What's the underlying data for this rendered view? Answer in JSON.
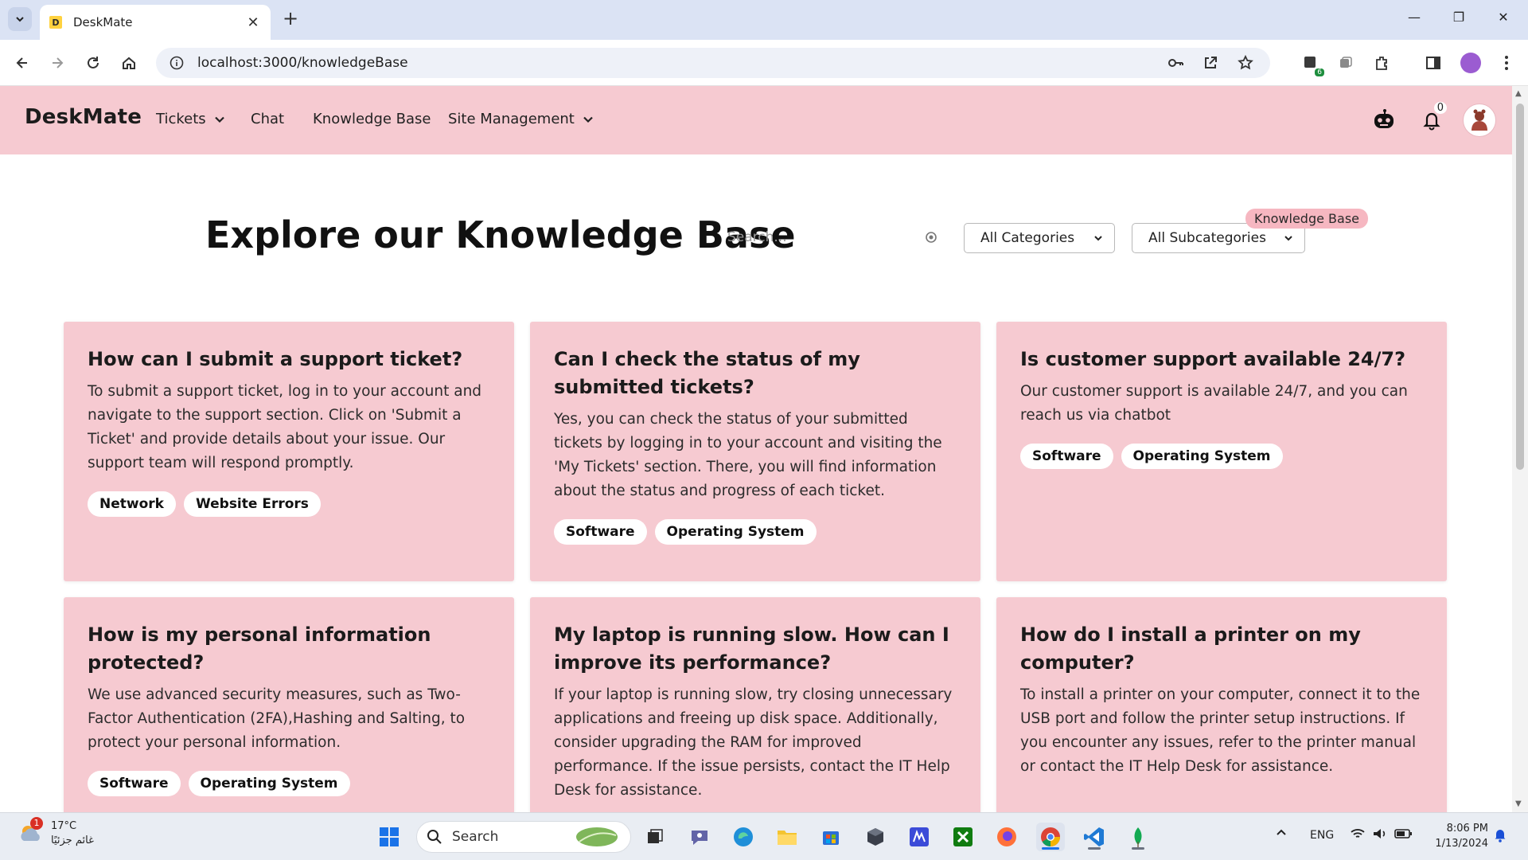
{
  "browser": {
    "tab_title": "DeskMate",
    "favicon_letter": "D",
    "url": "localhost:3000/knowledgeBase",
    "extension_badge": "6"
  },
  "app": {
    "brand": "DeskMate",
    "nav": {
      "tickets": "Tickets",
      "chat": "Chat",
      "knowledge_base": "Knowledge Base",
      "site_management": "Site Management"
    },
    "notification_count": "0"
  },
  "hero": {
    "title": "Explore our Knowledge Base",
    "search_placeholder": "Search...",
    "category_select": "All Categories",
    "subcategory_select": "All Subcategories",
    "tooltip": "Knowledge Base"
  },
  "articles": [
    {
      "title": "How can I submit a support ticket?",
      "body": "To submit a support ticket, log in to your account and navigate to the support section. Click on 'Submit a Ticket' and provide details about your issue. Our support team will respond promptly.",
      "tags": [
        "Network",
        "Website Errors"
      ]
    },
    {
      "title": "Can I check the status of my submitted tickets?",
      "body": "Yes, you can check the status of your submitted tickets by logging in to your account and visiting the 'My Tickets' section. There, you will find information about the status and progress of each ticket.",
      "tags": [
        "Software",
        "Operating System"
      ]
    },
    {
      "title": "Is customer support available 24/7?",
      "body": "Our customer support is available 24/7, and you can reach us via chatbot",
      "tags": [
        "Software",
        "Operating System"
      ]
    },
    {
      "title": "How is my personal information protected?",
      "body": "We use advanced security measures, such as Two-Factor Authentication (2FA),Hashing and Salting, to protect your personal information.",
      "tags": [
        "Software",
        "Operating System"
      ]
    },
    {
      "title": "My laptop is running slow. How can I improve its performance?",
      "body": "If your laptop is running slow, try closing unnecessary applications and freeing up disk space. Additionally, consider upgrading the RAM for improved performance. If the issue persists, contact the IT Help Desk for assistance.",
      "tags": []
    },
    {
      "title": "How do I install a printer on my computer?",
      "body": "To install a printer on your computer, connect it to the USB port and follow the printer setup instructions. If you encounter any issues, refer to the printer manual or contact the IT Help Desk for assistance.",
      "tags": []
    }
  ],
  "taskbar": {
    "weather_temp": "17°C",
    "weather_desc": "غائم جزئيًا",
    "weather_alert": "1",
    "search_label": "Search",
    "language": "ENG",
    "time": "8:06 PM",
    "date": "1/13/2024"
  },
  "colors": {
    "navbar_bg": "#f6cad1",
    "card_bg": "#f6cad1",
    "tooltip_bg": "#f6b7c1"
  }
}
